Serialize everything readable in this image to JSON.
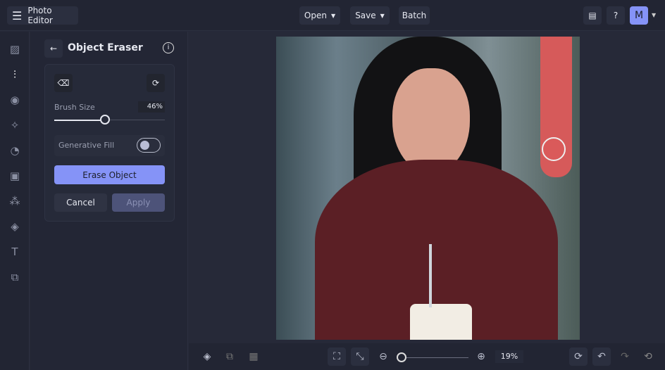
{
  "header": {
    "app_title": "Photo Editor",
    "open_label": "Open",
    "save_label": "Save",
    "batch_label": "Batch",
    "avatar_initial": "M"
  },
  "panel": {
    "title": "Object Eraser",
    "brush_size_label": "Brush Size",
    "brush_size_value": "46%",
    "brush_size_percent": 46,
    "generative_fill_label": "Generative Fill",
    "generative_fill_on": false,
    "erase_label": "Erase Object",
    "cancel_label": "Cancel",
    "apply_label": "Apply"
  },
  "footer": {
    "zoom_value": "19%"
  },
  "colors": {
    "accent": "#8593f7",
    "apply_bg": "#4d5379"
  }
}
